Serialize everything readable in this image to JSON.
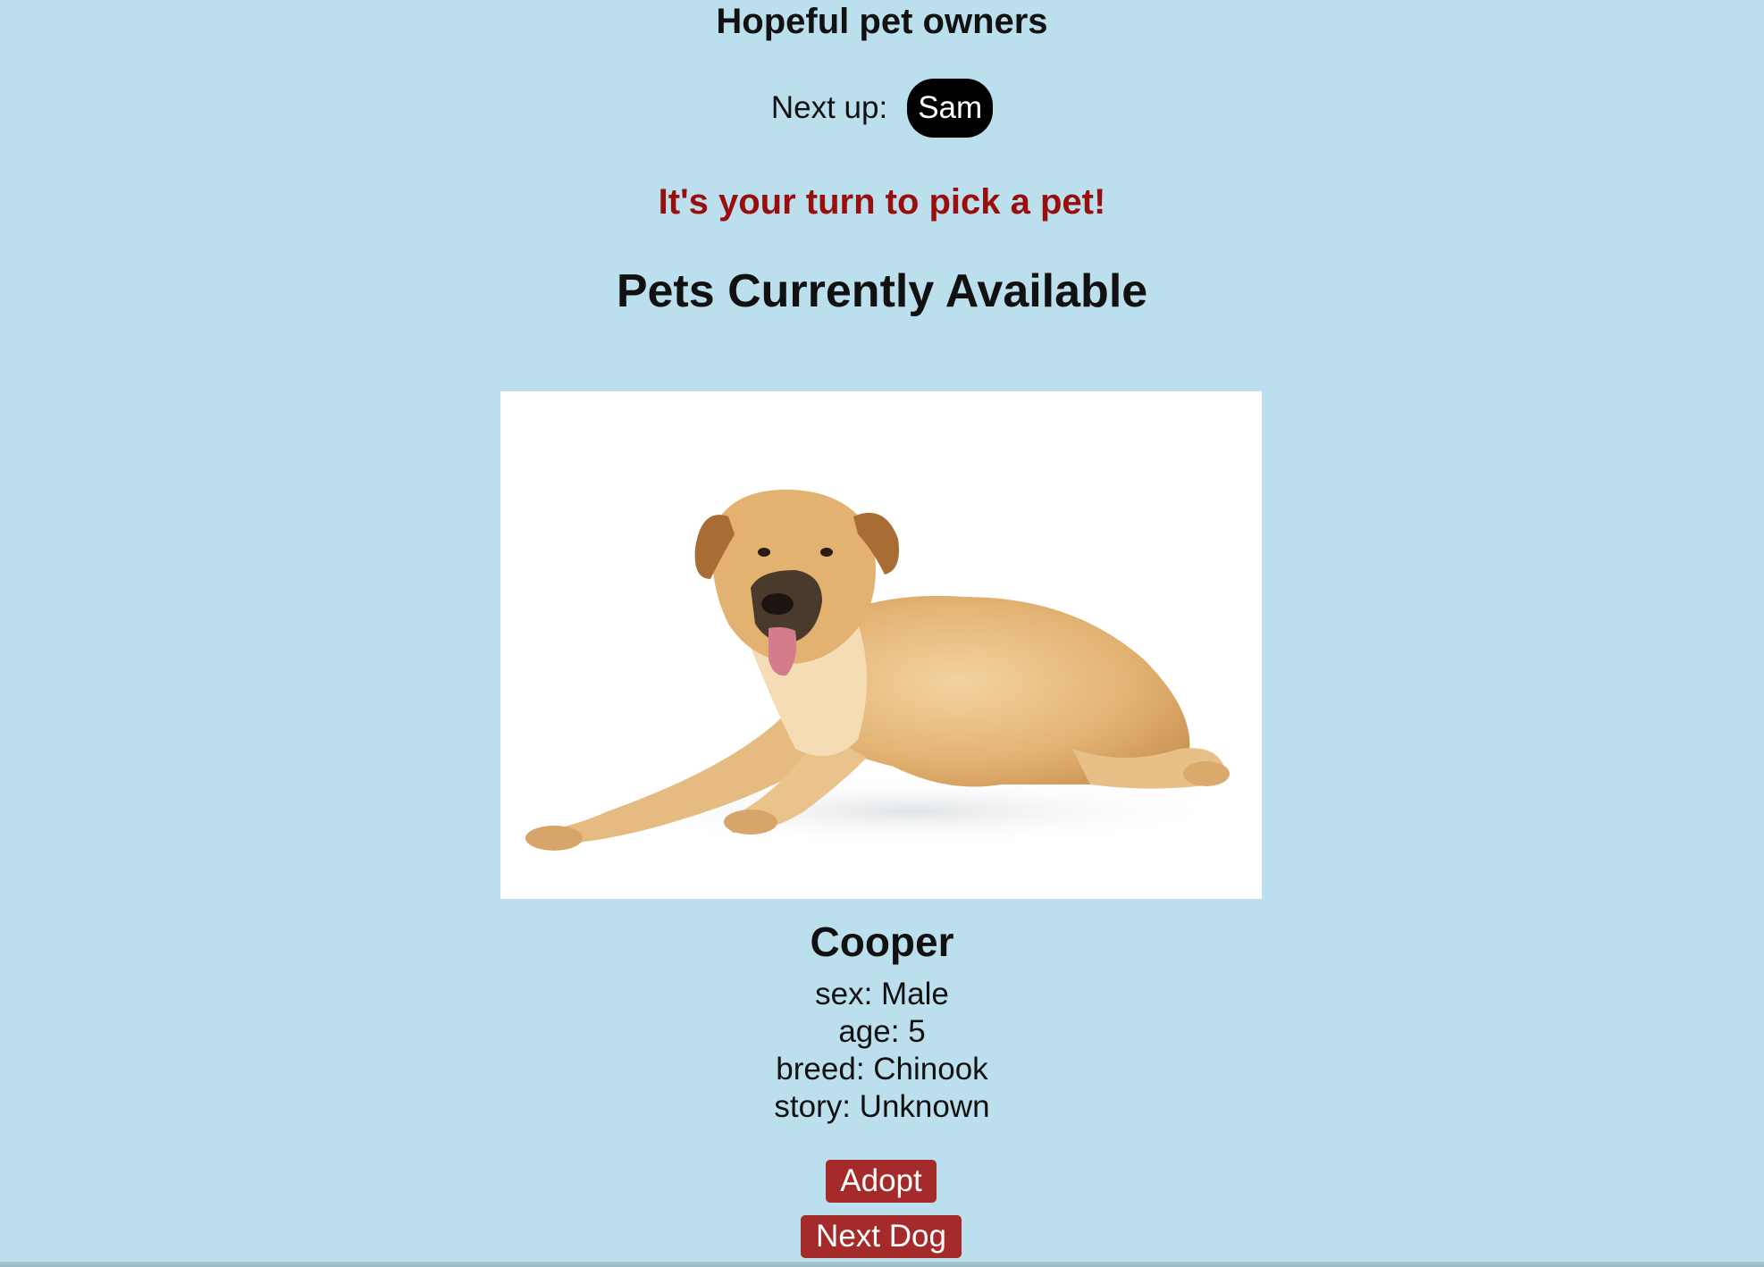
{
  "header": {
    "title": "Hopeful pet owners",
    "next_up_label": "Next up:",
    "next_up_name": "Sam"
  },
  "turn_message": "It's your turn to pick a pet!",
  "pets_section": {
    "title": "Pets Currently Available"
  },
  "pet": {
    "image_icon": "dog-photo",
    "name": "Cooper",
    "sex": "sex: Male",
    "age": "age: 5",
    "breed": "breed: Chinook",
    "story": "story: Unknown"
  },
  "actions": {
    "adopt_label": "Adopt",
    "next_label": "Next Dog"
  },
  "colors": {
    "background": "#bcdfed",
    "accent_red": "#990d0d",
    "button_red": "#a52a2a",
    "pill_black": "#000000"
  }
}
